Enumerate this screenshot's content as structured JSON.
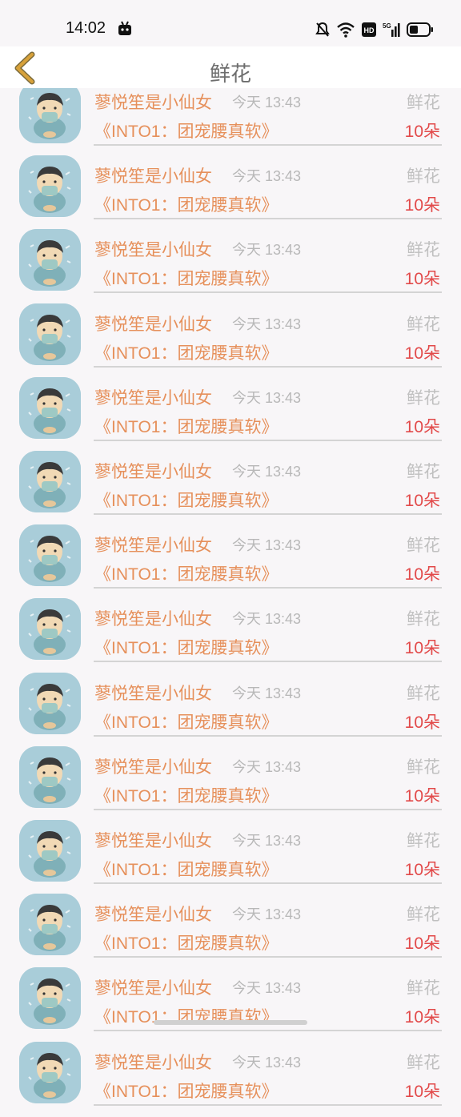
{
  "status_bar": {
    "time": "14:02",
    "icons": [
      "app-notification-icon",
      "mute-bell-icon",
      "wifi-icon",
      "hd-icon",
      "signal-5g-icon",
      "battery-icon"
    ],
    "hd_label": "HD",
    "net_label": "5G"
  },
  "header": {
    "title": "鲜花",
    "back_icon": "chevron-left-icon",
    "back_color": "#d7a13a"
  },
  "list": {
    "rows": [
      {
        "name": "蓼悦笙是小仙女",
        "time": "今天 13:43",
        "gift": "鲜花",
        "program": "《INTO1：团宠腰真软》",
        "amount": "10朵"
      },
      {
        "name": "蓼悦笙是小仙女",
        "time": "今天 13:43",
        "gift": "鲜花",
        "program": "《INTO1：团宠腰真软》",
        "amount": "10朵"
      },
      {
        "name": "蓼悦笙是小仙女",
        "time": "今天 13:43",
        "gift": "鲜花",
        "program": "《INTO1：团宠腰真软》",
        "amount": "10朵"
      },
      {
        "name": "蓼悦笙是小仙女",
        "time": "今天 13:43",
        "gift": "鲜花",
        "program": "《INTO1：团宠腰真软》",
        "amount": "10朵"
      },
      {
        "name": "蓼悦笙是小仙女",
        "time": "今天 13:43",
        "gift": "鲜花",
        "program": "《INTO1：团宠腰真软》",
        "amount": "10朵"
      },
      {
        "name": "蓼悦笙是小仙女",
        "time": "今天 13:43",
        "gift": "鲜花",
        "program": "《INTO1：团宠腰真软》",
        "amount": "10朵"
      },
      {
        "name": "蓼悦笙是小仙女",
        "time": "今天 13:43",
        "gift": "鲜花",
        "program": "《INTO1：团宠腰真软》",
        "amount": "10朵"
      },
      {
        "name": "蓼悦笙是小仙女",
        "time": "今天 13:43",
        "gift": "鲜花",
        "program": "《INTO1：团宠腰真软》",
        "amount": "10朵"
      },
      {
        "name": "蓼悦笙是小仙女",
        "time": "今天 13:43",
        "gift": "鲜花",
        "program": "《INTO1：团宠腰真软》",
        "amount": "10朵"
      },
      {
        "name": "蓼悦笙是小仙女",
        "time": "今天 13:43",
        "gift": "鲜花",
        "program": "《INTO1：团宠腰真软》",
        "amount": "10朵"
      },
      {
        "name": "蓼悦笙是小仙女",
        "time": "今天 13:43",
        "gift": "鲜花",
        "program": "《INTO1：团宠腰真软》",
        "amount": "10朵"
      },
      {
        "name": "蓼悦笙是小仙女",
        "time": "今天 13:43",
        "gift": "鲜花",
        "program": "《INTO1：团宠腰真软》",
        "amount": "10朵"
      },
      {
        "name": "蓼悦笙是小仙女",
        "time": "今天 13:43",
        "gift": "鲜花",
        "program": "《INTO1：团宠腰真软》",
        "amount": "10朵"
      },
      {
        "name": "蓼悦笙是小仙女",
        "time": "今天 13:43",
        "gift": "鲜花",
        "program": "《INTO1：团宠腰真软》",
        "amount": "10朵"
      }
    ]
  },
  "colors": {
    "name": "#e6905b",
    "amount": "#e24a4a",
    "muted": "#b8b8b8",
    "avatar_bg": "#a9cdd9"
  }
}
